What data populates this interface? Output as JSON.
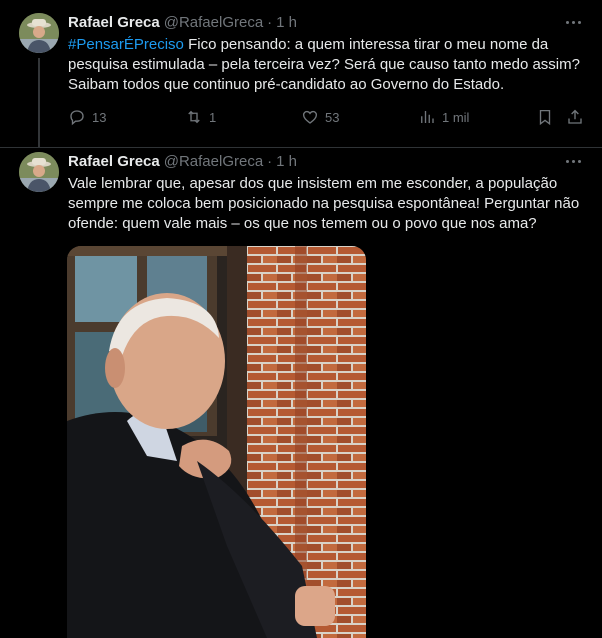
{
  "tweets": [
    {
      "name": "Rafael Greca",
      "handle": "@RafaelGreca",
      "dot": "·",
      "time": "1 h",
      "hashtag": "#PensarÉPreciso",
      "text": " Fico pensando: a quem interessa tirar o meu nome da pesquisa estimulada – pela terceira vez? Será que causo tanto medo assim? Saibam todos que continuo pré-candidato ao Governo do Estado.",
      "replies": "13",
      "reposts": "1",
      "likes": "53",
      "views": "1 mil"
    },
    {
      "name": "Rafael Greca",
      "handle": "@RafaelGreca",
      "dot": "·",
      "time": "1 h",
      "text": "Vale lembrar que, apesar dos que insistem em me esconder, a população sempre me coloca bem posicionado na pesquisa espontânea! Perguntar não ofende: quem vale mais – os que nos temem ou o povo que nos ama?"
    }
  ],
  "colors": {
    "background": "#000000",
    "text": "#e7e9ea",
    "secondary": "#71767b",
    "link": "#1d9bf0",
    "divider": "#2f3336"
  },
  "icons": [
    "more-icon",
    "reply-icon",
    "repost-icon",
    "like-icon",
    "views-icon",
    "bookmark-icon",
    "share-icon"
  ]
}
